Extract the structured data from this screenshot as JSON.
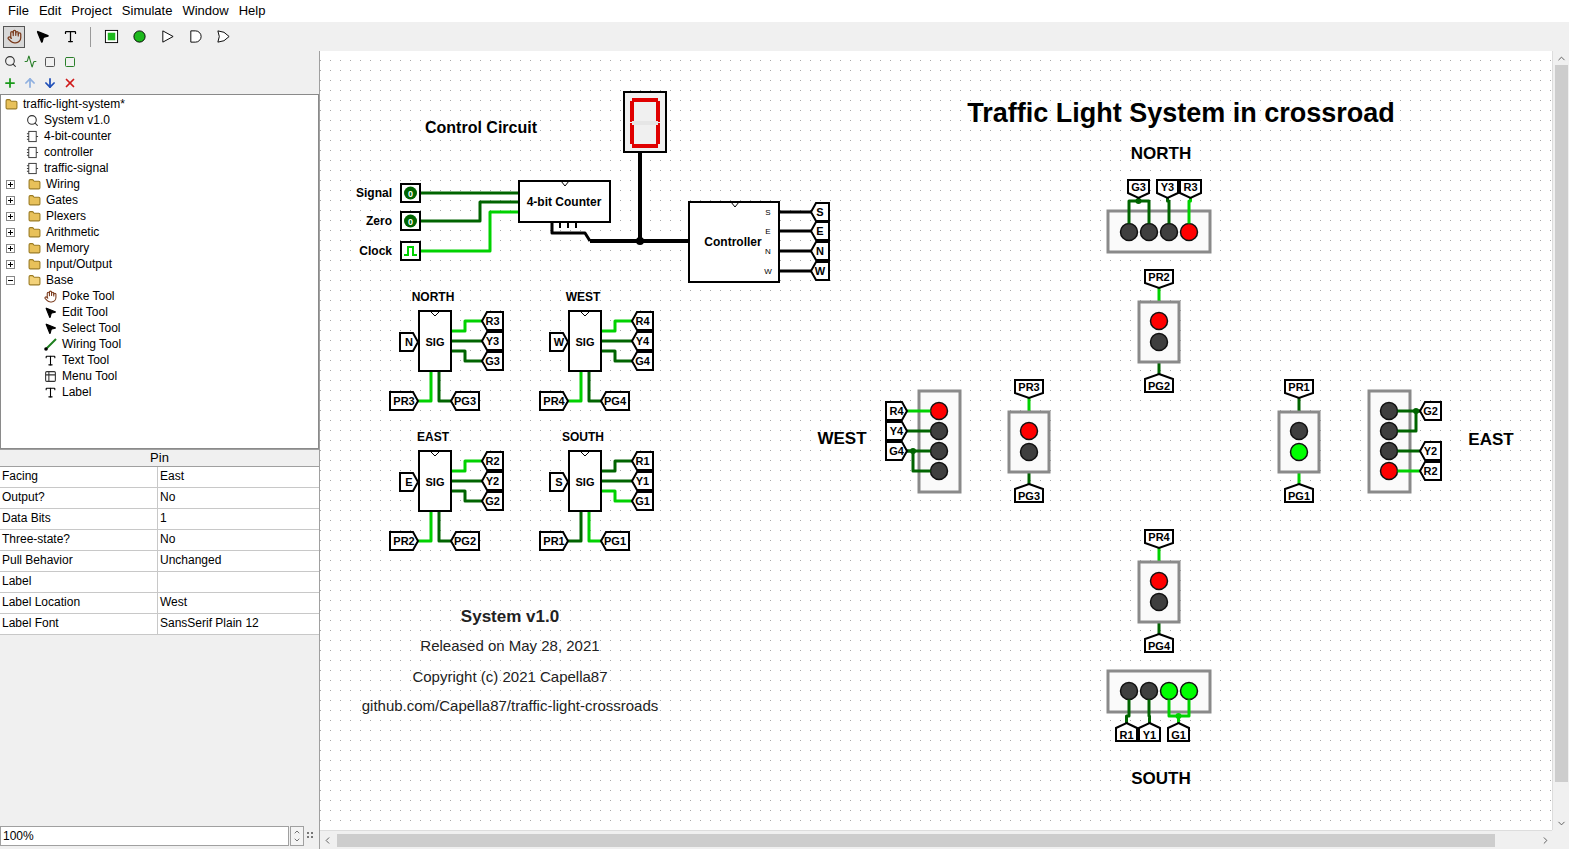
{
  "menu": [
    "File",
    "Edit",
    "Project",
    "Simulate",
    "Window",
    "Help"
  ],
  "toolbar": [
    {
      "selected": true
    },
    {
      "selected": false
    },
    {
      "selected": false
    },
    {
      "selected": false
    },
    {
      "selected": false
    },
    {
      "selected": false
    },
    {
      "selected": false
    },
    {
      "selected": false
    }
  ],
  "explorer": {
    "items": [
      {
        "label": "traffic-light-system*",
        "kind": "project",
        "expanded": true
      },
      {
        "label": "System v1.0",
        "kind": "current-circuit",
        "expanded": false
      },
      {
        "label": "4-bit-counter",
        "kind": "circuit",
        "expanded": false
      },
      {
        "label": "controller",
        "kind": "circuit",
        "expanded": false
      },
      {
        "label": "traffic-signal",
        "kind": "circuit",
        "expanded": false
      },
      {
        "label": "Wiring",
        "kind": "folder",
        "expanded": false
      },
      {
        "label": "Gates",
        "kind": "folder",
        "expanded": false
      },
      {
        "label": "Plexers",
        "kind": "folder",
        "expanded": false
      },
      {
        "label": "Arithmetic",
        "kind": "folder",
        "expanded": false
      },
      {
        "label": "Memory",
        "kind": "folder",
        "expanded": false
      },
      {
        "label": "Input/Output",
        "kind": "folder",
        "expanded": false
      },
      {
        "label": "Base",
        "kind": "folder",
        "expanded": true
      },
      {
        "label": "Poke Tool",
        "kind": "tool",
        "expanded": false
      },
      {
        "label": "Edit Tool",
        "kind": "tool",
        "expanded": false
      },
      {
        "label": "Select Tool",
        "kind": "tool",
        "expanded": false
      },
      {
        "label": "Wiring Tool",
        "kind": "tool",
        "expanded": false
      },
      {
        "label": "Text Tool",
        "kind": "tool",
        "expanded": false
      },
      {
        "label": "Menu Tool",
        "kind": "tool",
        "expanded": false
      },
      {
        "label": "Label",
        "kind": "tool",
        "expanded": false
      }
    ]
  },
  "attributes": {
    "title": "Pin",
    "rows": [
      {
        "name": "Facing",
        "value": "East"
      },
      {
        "name": "Output?",
        "value": "No"
      },
      {
        "name": "Data Bits",
        "value": "1"
      },
      {
        "name": "Three-state?",
        "value": "No"
      },
      {
        "name": "Pull Behavior",
        "value": "Unchanged"
      },
      {
        "name": "Label",
        "value": ""
      },
      {
        "name": "Label Location",
        "value": "West"
      },
      {
        "name": "Label Font",
        "value": "SansSerif Plain 12"
      }
    ]
  },
  "zoom": "100%",
  "canvas": {
    "title": "Traffic Light System in crossroad",
    "control_label": "Control Circuit",
    "inputs": [
      {
        "label": "Signal",
        "kind": "pin",
        "value": "0",
        "on": false
      },
      {
        "label": "Zero",
        "kind": "pin",
        "value": "0",
        "on": false
      },
      {
        "label": "Clock",
        "kind": "clock",
        "value": "",
        "on": true
      }
    ],
    "counter": {
      "label": "4-bit Counter"
    },
    "display": {
      "segments": {
        "a": true,
        "b": true,
        "c": true,
        "d": true,
        "e": true,
        "f": true,
        "g": false
      }
    },
    "controller": {
      "label": "Controller",
      "ports": [
        "S",
        "E",
        "N",
        "W"
      ],
      "tunnels": [
        "S",
        "E",
        "N",
        "W"
      ]
    },
    "signal_blocks": [
      {
        "heading": "NORTH",
        "input": "N",
        "label": "SIG",
        "outputs": [
          {
            "label": "R3",
            "on": true
          },
          {
            "label": "Y3",
            "on": false
          },
          {
            "label": "G3",
            "on": false
          }
        ],
        "ped": [
          {
            "label": "PR3",
            "on": true
          },
          {
            "label": "PG3",
            "on": false
          }
        ]
      },
      {
        "heading": "WEST",
        "input": "W",
        "label": "SIG",
        "outputs": [
          {
            "label": "R4",
            "on": true
          },
          {
            "label": "Y4",
            "on": false
          },
          {
            "label": "G4",
            "on": false
          }
        ],
        "ped": [
          {
            "label": "PR4",
            "on": true
          },
          {
            "label": "PG4",
            "on": false
          }
        ]
      },
      {
        "heading": "EAST",
        "input": "E",
        "label": "SIG",
        "outputs": [
          {
            "label": "R2",
            "on": true
          },
          {
            "label": "Y2",
            "on": false
          },
          {
            "label": "G2",
            "on": false
          }
        ],
        "ped": [
          {
            "label": "PR2",
            "on": true
          },
          {
            "label": "PG2",
            "on": false
          }
        ]
      },
      {
        "heading": "SOUTH",
        "input": "S",
        "label": "SIG",
        "outputs": [
          {
            "label": "R1",
            "on": false
          },
          {
            "label": "Y1",
            "on": false
          },
          {
            "label": "G1",
            "on": true
          }
        ],
        "ped": [
          {
            "label": "PR1",
            "on": false
          },
          {
            "label": "PG1",
            "on": true
          }
        ]
      }
    ],
    "compass": [
      "NORTH",
      "WEST",
      "EAST",
      "SOUTH"
    ],
    "car_lights": [
      {
        "signals": [
          {
            "label": "G3",
            "on": false
          },
          {
            "label": "Y3",
            "on": false
          },
          {
            "label": "R3",
            "on": true
          }
        ],
        "lamps": [
          {
            "on": false,
            "color": "#00ff00"
          },
          {
            "on": false,
            "color": "#00ff00"
          },
          {
            "on": false,
            "color": "#ffff00"
          },
          {
            "on": true,
            "color": "#ff0000"
          }
        ]
      },
      {
        "signals": [
          {
            "label": "R4",
            "on": true
          },
          {
            "label": "Y4",
            "on": false
          },
          {
            "label": "G4",
            "on": false
          }
        ],
        "lamps": [
          {
            "on": true,
            "color": "#ff0000"
          },
          {
            "on": false,
            "color": "#ffff00"
          },
          {
            "on": false,
            "color": "#00ff00"
          },
          {
            "on": false,
            "color": "#00ff00"
          }
        ]
      },
      {
        "signals": [
          {
            "label": "G2",
            "on": false
          },
          {
            "label": "Y2",
            "on": false
          },
          {
            "label": "R2",
            "on": true
          }
        ],
        "lamps": [
          {
            "on": false,
            "color": "#00ff00"
          },
          {
            "on": false,
            "color": "#00ff00"
          },
          {
            "on": false,
            "color": "#ffff00"
          },
          {
            "on": true,
            "color": "#ff0000"
          }
        ]
      },
      {
        "signals": [
          {
            "label": "R1",
            "on": false
          },
          {
            "label": "Y1",
            "on": false
          },
          {
            "label": "G1",
            "on": true
          }
        ],
        "lamps": [
          {
            "on": false,
            "color": "#ff0000"
          },
          {
            "on": false,
            "color": "#ffff00"
          },
          {
            "on": true,
            "color": "#00ff00"
          },
          {
            "on": true,
            "color": "#00ff00"
          }
        ]
      }
    ],
    "ped_lights": [
      {
        "signals": [
          {
            "label": "PR2",
            "on": true
          },
          {
            "label": "PG2",
            "on": false
          }
        ],
        "lamps": [
          {
            "on": true,
            "color": "#ff0000"
          },
          {
            "on": false,
            "color": "#00ff00"
          }
        ]
      },
      {
        "signals": [
          {
            "label": "PR3",
            "on": true
          },
          {
            "label": "PG3",
            "on": false
          }
        ],
        "lamps": [
          {
            "on": true,
            "color": "#ff0000"
          },
          {
            "on": false,
            "color": "#00ff00"
          }
        ]
      },
      {
        "signals": [
          {
            "label": "PR1",
            "on": false
          },
          {
            "label": "PG1",
            "on": true
          }
        ],
        "lamps": [
          {
            "on": false,
            "color": "#ff0000"
          },
          {
            "on": true,
            "color": "#00ff00"
          }
        ]
      },
      {
        "signals": [
          {
            "label": "PR4",
            "on": true
          },
          {
            "label": "PG4",
            "on": false
          }
        ],
        "lamps": [
          {
            "on": true,
            "color": "#ff0000"
          },
          {
            "on": false,
            "color": "#00ff00"
          }
        ]
      }
    ],
    "info": [
      "System v1.0",
      "Released on May 28, 2021",
      "Copyright (c) 2021 Capella87",
      "github.com/Capella87/traffic-light-crossroads"
    ]
  }
}
